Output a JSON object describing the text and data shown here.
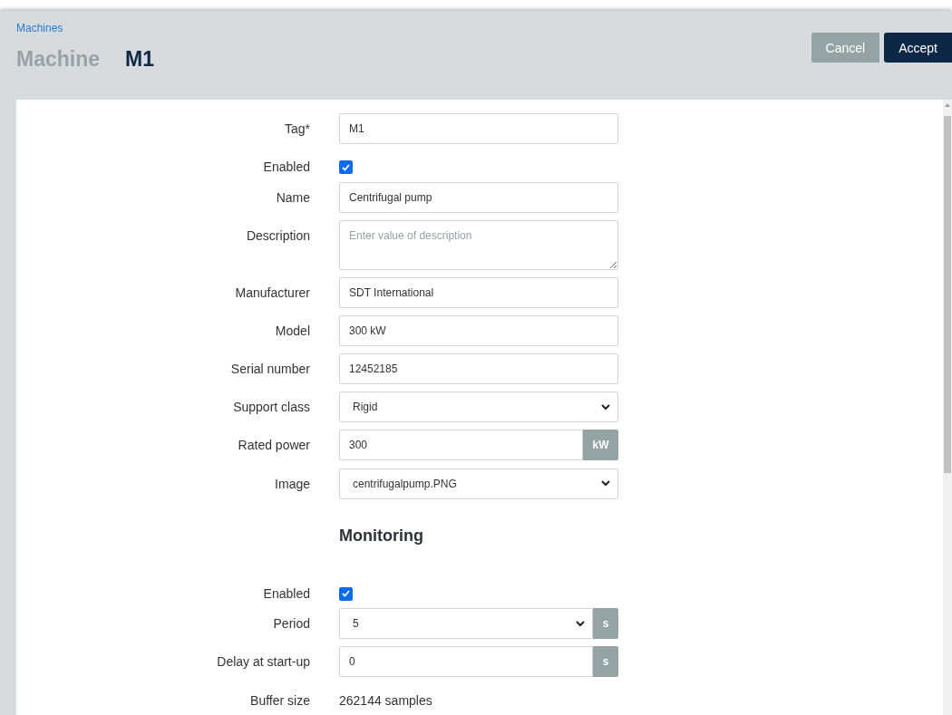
{
  "breadcrumb": "Machines",
  "title": {
    "kind_label": "Machine",
    "value": "M1"
  },
  "buttons": [
    {
      "label": "Cancel",
      "kind": "secondary"
    },
    {
      "label": "Accept",
      "kind": "primary"
    }
  ],
  "sections": [
    {
      "fields": [
        {
          "kind": "text",
          "label": "Tag*",
          "value": "M1"
        },
        {
          "kind": "checkbox",
          "label": "Enabled",
          "checked": true
        },
        {
          "kind": "text",
          "label": "Name",
          "value": "Centrifugal pump"
        },
        {
          "kind": "textarea",
          "label": "Description",
          "placeholder": "Enter value of description"
        },
        {
          "kind": "text",
          "label": "Manufacturer",
          "value": "SDT International"
        },
        {
          "kind": "text",
          "label": "Model",
          "value": "300 kW"
        },
        {
          "kind": "text",
          "label": "Serial number",
          "value": "12452185"
        },
        {
          "kind": "select",
          "label": "Support class",
          "value": "Rigid"
        },
        {
          "kind": "text",
          "label": "Rated power",
          "value": "300",
          "unit": "kW"
        },
        {
          "kind": "select",
          "label": "Image",
          "value": "centrifugalpump.PNG"
        }
      ]
    },
    {
      "heading": "Monitoring",
      "fields": [
        {
          "kind": "checkbox",
          "label": "Enabled",
          "checked": true
        },
        {
          "kind": "select",
          "label": "Period",
          "value": "5",
          "unit": "s"
        },
        {
          "kind": "text",
          "label": "Delay at start-up",
          "value": "0",
          "unit": "s"
        },
        {
          "kind": "static",
          "label": "Buffer size",
          "value": "262144 samples"
        }
      ]
    }
  ]
}
